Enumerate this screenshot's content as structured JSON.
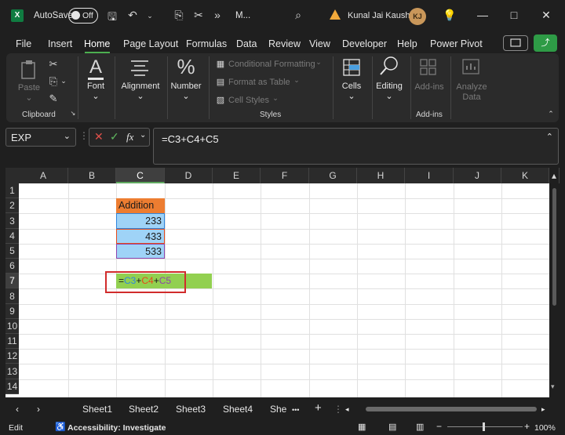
{
  "titlebar": {
    "logo": "X",
    "autosave_label": "AutoSave",
    "autosave_state": "Off",
    "document_title": "M...",
    "user_name": "Kunal Jai Kaushik",
    "user_initials": "KJ"
  },
  "menu": {
    "items": [
      "File",
      "Insert",
      "Home",
      "Page Layout",
      "Formulas",
      "Data",
      "Review",
      "View",
      "Developer",
      "Help",
      "Power Pivot"
    ],
    "active": "Home"
  },
  "ribbon": {
    "clipboard": {
      "paste": "Paste",
      "label": "Clipboard"
    },
    "font": {
      "label": "Font"
    },
    "alignment": {
      "label": "Alignment"
    },
    "number": {
      "label": "Number"
    },
    "styles": {
      "conditional_formatting": "Conditional Formatting",
      "format_as_table": "Format as Table",
      "cell_styles": "Cell Styles",
      "label": "Styles"
    },
    "cells": {
      "label": "Cells"
    },
    "editing": {
      "label": "Editing"
    },
    "addins": {
      "button": "Add-ins",
      "label": "Add-ins"
    },
    "analyze": {
      "line1": "Analyze",
      "line2": "Data"
    }
  },
  "formula_bar": {
    "name_box": "EXP",
    "formula": "=C3+C4+C5",
    "fx": "fx"
  },
  "grid": {
    "columns": [
      "A",
      "B",
      "C",
      "D",
      "E",
      "F",
      "G",
      "H",
      "I",
      "J",
      "K"
    ],
    "rows": [
      "1",
      "2",
      "3",
      "4",
      "5",
      "6",
      "7",
      "8",
      "9",
      "10",
      "11",
      "12",
      "13",
      "14"
    ],
    "cells": {
      "C2": "Addition",
      "C3": "233",
      "C4": "433",
      "C5": "533"
    },
    "edit_cell": {
      "prefix": "=",
      "ref1": "C3",
      "op1": "+",
      "ref2": "C4",
      "op2": "+",
      "ref3": "C5"
    },
    "colors": {
      "header_fill": "#ed7d31",
      "value_fill": "#9fd3f7",
      "edit_fill": "#92d050",
      "ref1": "#2e86de",
      "ref2": "#e64a19",
      "ref3": "#8e44ad",
      "highlight_box": "#d12c2c"
    }
  },
  "sheets": {
    "tabs": [
      "Sheet1",
      "Sheet2",
      "Sheet3",
      "Sheet4",
      "She"
    ],
    "more": "•••",
    "add": "+"
  },
  "status": {
    "mode": "Edit",
    "accessibility": "Accessibility: Investigate",
    "zoom": "100%"
  }
}
